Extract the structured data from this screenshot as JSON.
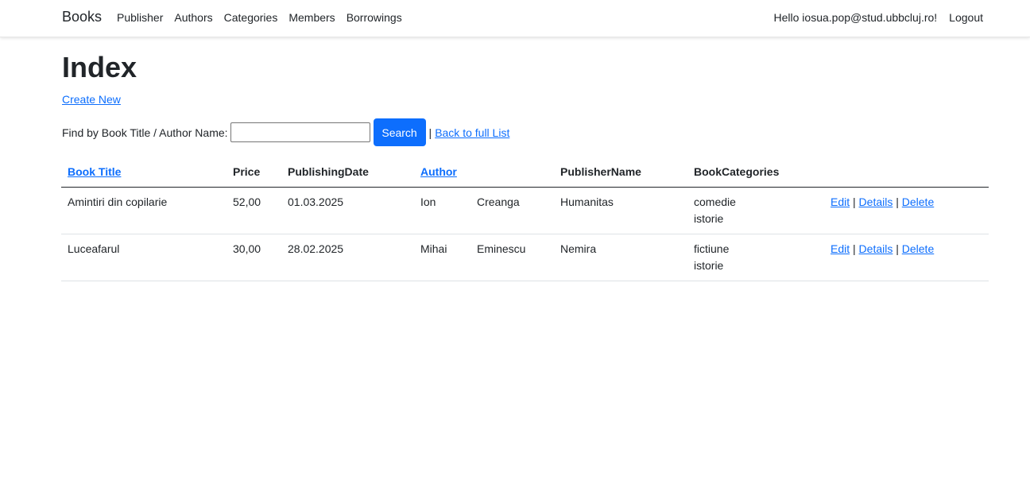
{
  "nav": {
    "brand": "Books",
    "items": [
      "Publisher",
      "Authors",
      "Categories",
      "Members",
      "Borrowings"
    ],
    "greeting": "Hello iosua.pop@stud.ubbcluj.ro!",
    "logout": "Logout"
  },
  "page": {
    "title": "Index",
    "create_new": "Create New"
  },
  "search": {
    "label": "Find by Book Title / Author Name:",
    "value": "",
    "button": "Search",
    "separator": "|",
    "back_link": "Back to full List"
  },
  "table": {
    "headers": {
      "title": "Book Title",
      "price": "Price",
      "date": "PublishingDate",
      "author": "Author",
      "publisher": "PublisherName",
      "categories": "BookCategories"
    },
    "actions": {
      "edit": "Edit",
      "details": "Details",
      "delete": "Delete",
      "sep": "|"
    },
    "rows": [
      {
        "title": "Amintiri din copilarie",
        "price": "52,00",
        "date": "01.03.2025",
        "first": "Ion",
        "last": "Creanga",
        "publisher": "Humanitas",
        "cat1": "comedie",
        "cat2": "istorie"
      },
      {
        "title": "Luceafarul",
        "price": "30,00",
        "date": "28.02.2025",
        "first": "Mihai",
        "last": "Eminescu",
        "publisher": "Nemira",
        "cat1": "fictiune",
        "cat2": "istorie"
      }
    ]
  }
}
